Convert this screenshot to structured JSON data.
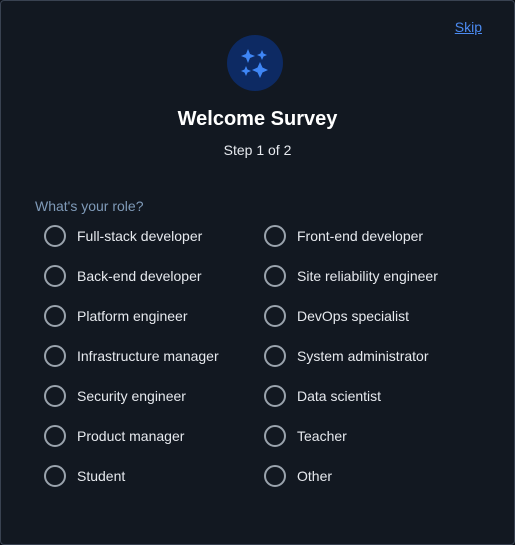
{
  "header": {
    "skip_label": "Skip",
    "title": "Welcome Survey",
    "step": "Step 1 of 2",
    "badge_icon": "sparkles-icon"
  },
  "question": {
    "label": "What's your role?",
    "options": [
      "Full-stack developer",
      "Front-end developer",
      "Back-end developer",
      "Site reliability engineer",
      "Platform engineer",
      "DevOps specialist",
      "Infrastructure manager",
      "System administrator",
      "Security engineer",
      "Data scientist",
      "Product manager",
      "Teacher",
      "Student",
      "Other"
    ]
  },
  "colors": {
    "background": "#121821",
    "accent": "#4b8af0",
    "badge": "#0d2a63",
    "question_label": "#7f9ab8"
  }
}
